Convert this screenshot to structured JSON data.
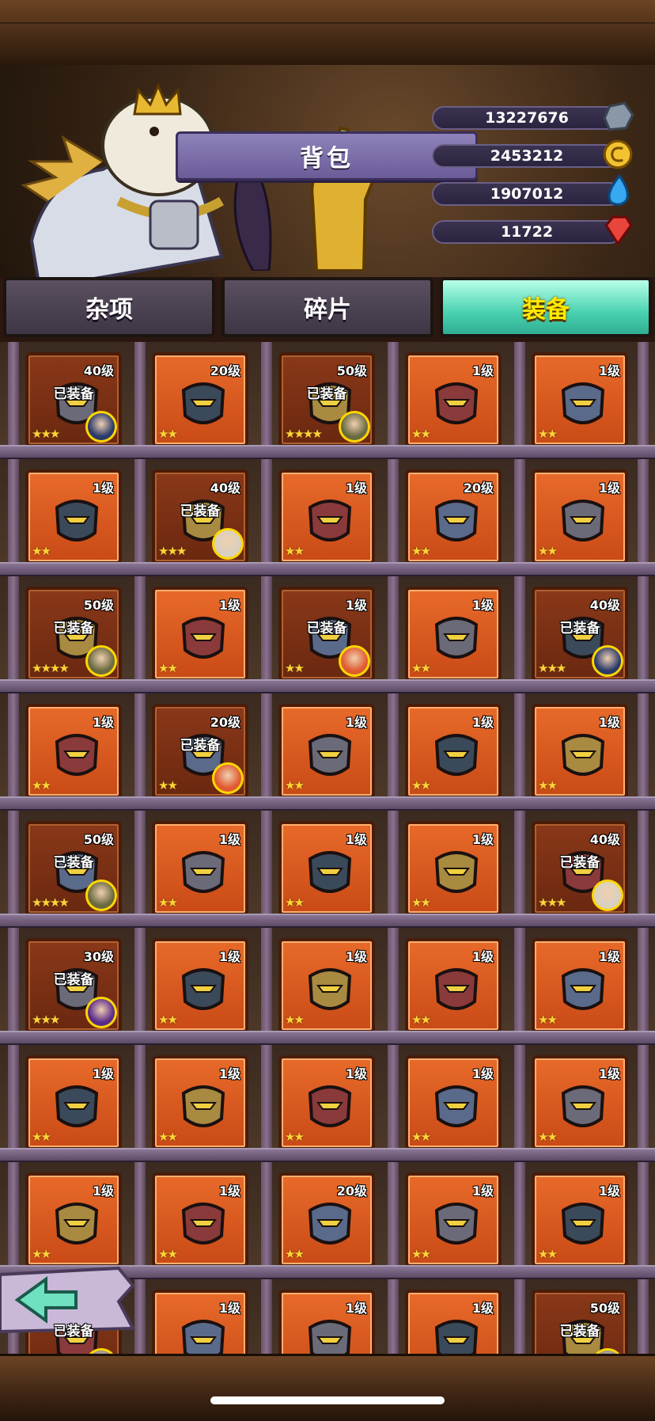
{
  "title": "背包",
  "resources": [
    {
      "value": "13227676",
      "icon": "stone-icon",
      "color": "#8a97a6"
    },
    {
      "value": "2453212",
      "icon": "gold-coin-icon",
      "color": "#f2c230"
    },
    {
      "value": "1907012",
      "icon": "water-drop-icon",
      "color": "#38a8f0"
    },
    {
      "value": "11722",
      "icon": "red-gem-icon",
      "color": "#e8453c"
    }
  ],
  "tabs": [
    {
      "label": "杂项",
      "active": false
    },
    {
      "label": "碎片",
      "active": false
    },
    {
      "label": "装备",
      "active": true
    }
  ],
  "equipped_label": "已装备",
  "rows": [
    [
      {
        "level": "40级",
        "equipped": true,
        "stars": 3,
        "icon": "glove-icon",
        "hero": "dark-mage"
      },
      {
        "level": "20级",
        "equipped": false,
        "stars": 2,
        "icon": "green-helmet-icon"
      },
      {
        "level": "50级",
        "equipped": true,
        "stars": 4,
        "icon": "helmet-icon",
        "hero": "hooded"
      },
      {
        "level": "1级",
        "equipped": false,
        "stars": 2,
        "icon": "red-mask-helmet-icon"
      },
      {
        "level": "1级",
        "equipped": false,
        "stars": 2,
        "icon": "red-mask-helmet-icon"
      }
    ],
    [
      {
        "level": "1级",
        "equipped": false,
        "stars": 2,
        "icon": "red-mask-helmet-icon"
      },
      {
        "level": "40级",
        "equipped": true,
        "stars": 3,
        "icon": "dark-helmet-icon",
        "hero": "white-hair"
      },
      {
        "level": "1级",
        "equipped": false,
        "stars": 2,
        "icon": "gold-helmet-icon"
      },
      {
        "level": "20级",
        "equipped": false,
        "stars": 2,
        "icon": "visor-helmet-icon"
      },
      {
        "level": "1级",
        "equipped": false,
        "stars": 2,
        "icon": "visor-helmet-icon"
      }
    ],
    [
      {
        "level": "50级",
        "equipped": true,
        "stars": 4,
        "icon": "lightning-helmet-icon",
        "hero": "hooded"
      },
      {
        "level": "1级",
        "equipped": false,
        "stars": 2,
        "icon": "lightning-helmet-icon"
      },
      {
        "level": "1级",
        "equipped": true,
        "stars": 2,
        "icon": "teal-helmet-icon",
        "hero": "red-hair"
      },
      {
        "level": "1级",
        "equipped": false,
        "stars": 2,
        "icon": "teal-helmet-icon"
      },
      {
        "level": "40级",
        "equipped": true,
        "stars": 3,
        "icon": "chest-armor-icon",
        "hero": "dark-mage"
      }
    ],
    [
      {
        "level": "1级",
        "equipped": false,
        "stars": 2,
        "icon": "chest-armor-icon"
      },
      {
        "level": "20级",
        "equipped": true,
        "stars": 2,
        "icon": "dark-armor-icon",
        "hero": "red-hair"
      },
      {
        "level": "1级",
        "equipped": false,
        "stars": 2,
        "icon": "gold-armor-icon"
      },
      {
        "level": "1级",
        "equipped": false,
        "stars": 2,
        "icon": "gold-armor-icon"
      },
      {
        "level": "1级",
        "equipped": false,
        "stars": 2,
        "icon": "gold-armor-icon"
      }
    ],
    [
      {
        "level": "50级",
        "equipped": true,
        "stars": 4,
        "icon": "steel-armor-icon",
        "hero": "hooded"
      },
      {
        "level": "1级",
        "equipped": false,
        "stars": 2,
        "icon": "steel-armor-icon"
      },
      {
        "level": "1级",
        "equipped": false,
        "stars": 2,
        "icon": "steel-armor-icon"
      },
      {
        "level": "1级",
        "equipped": false,
        "stars": 2,
        "icon": "steel-armor-icon"
      },
      {
        "level": "40级",
        "equipped": true,
        "stars": 3,
        "icon": "steel-armor-icon",
        "hero": "white-hair"
      }
    ],
    [
      {
        "level": "30级",
        "equipped": true,
        "stars": 3,
        "icon": "dark-armor-icon",
        "hero": "purple-mage"
      },
      {
        "level": "1级",
        "equipped": false,
        "stars": 2,
        "icon": "silver-armor-icon"
      },
      {
        "level": "1级",
        "equipped": false,
        "stars": 2,
        "icon": "gauntlet-icon"
      },
      {
        "level": "1级",
        "equipped": false,
        "stars": 2,
        "icon": "flail-icon"
      },
      {
        "level": "1级",
        "equipped": false,
        "stars": 2,
        "icon": "flail-icon"
      }
    ],
    [
      {
        "level": "1级",
        "equipped": false,
        "stars": 2,
        "icon": "rock-icon"
      },
      {
        "level": "1级",
        "equipped": false,
        "stars": 2,
        "icon": "rock-icon"
      },
      {
        "level": "1级",
        "equipped": false,
        "stars": 2,
        "icon": "mech-arm-icon"
      },
      {
        "level": "1级",
        "equipped": false,
        "stars": 2,
        "icon": "hook-icon"
      },
      {
        "level": "1级",
        "equipped": false,
        "stars": 2,
        "icon": "hook-icon"
      }
    ],
    [
      {
        "level": "1级",
        "equipped": false,
        "stars": 2,
        "icon": "lantern-icon"
      },
      {
        "level": "1级",
        "equipped": false,
        "stars": 2,
        "icon": "device-icon"
      },
      {
        "level": "20级",
        "equipped": false,
        "stars": 2,
        "icon": "flask-icon"
      },
      {
        "level": "1级",
        "equipped": false,
        "stars": 2,
        "icon": "claw-icon"
      },
      {
        "level": "1级",
        "equipped": false,
        "stars": 2,
        "icon": "claw-icon"
      }
    ],
    [
      {
        "level": "",
        "equipped": true,
        "stars": 2,
        "icon": "item-icon",
        "hero": "none"
      },
      {
        "level": "1级",
        "equipped": false,
        "stars": 2,
        "icon": "item-icon"
      },
      {
        "level": "1级",
        "equipped": false,
        "stars": 2,
        "icon": "item-icon"
      },
      {
        "level": "1级",
        "equipped": false,
        "stars": 2,
        "icon": "item-icon"
      },
      {
        "level": "50级",
        "equipped": true,
        "stars": 2,
        "icon": "item-icon",
        "hero": "none"
      }
    ]
  ]
}
